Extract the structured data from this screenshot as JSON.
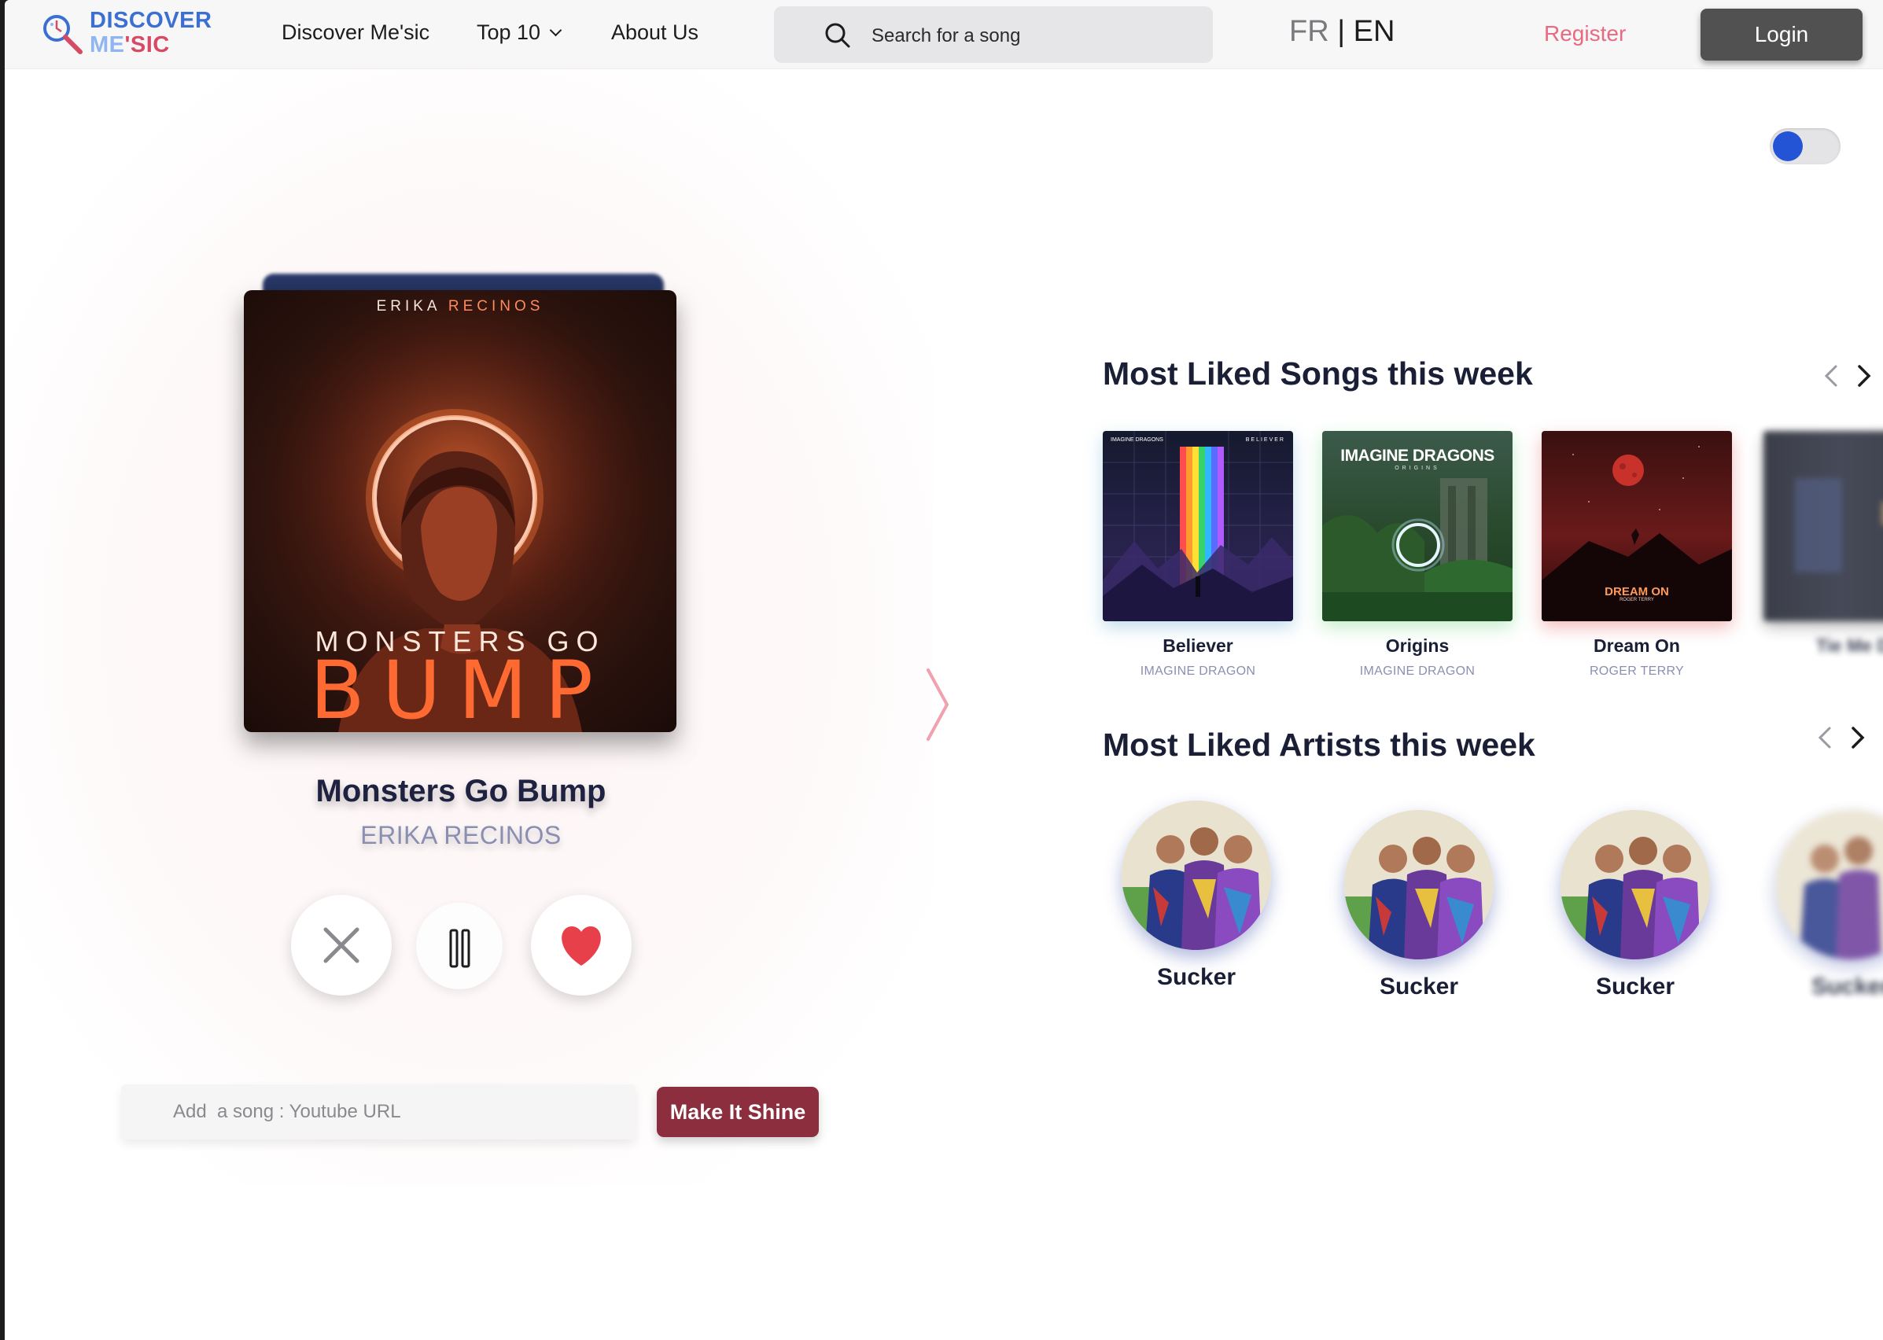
{
  "nav": {
    "logo_line1": "DISCOVER",
    "logo_line2_a": "ME",
    "logo_line2_b": "'SIC",
    "links": [
      "Discover Me'sic",
      "Top 10",
      "About Us"
    ],
    "search_placeholder": "Search for a song",
    "lang_fr": "FR",
    "lang_sep": " | ",
    "lang_en": "EN",
    "register": "Register",
    "login": "Login"
  },
  "player": {
    "cover_artist": {
      "first": "ERIKA",
      "last": "RECINOS"
    },
    "cover_title_small": "MONSTERS GO",
    "cover_title_big": "BUMP",
    "title": "Monsters Go Bump",
    "artist": "ERIKA RECINOS",
    "url_placeholder": "Add  a song : Youtube URL",
    "submit": "Make It Shine"
  },
  "theme_toggle": {
    "on": false,
    "knob_color": "#2454d6"
  },
  "songs_section": {
    "title": "Most Liked Songs this week",
    "items": [
      {
        "name": "Believer",
        "artist": "IMAGINE DRAGON"
      },
      {
        "name": "Origins",
        "artist": "IMAGINE DRAGON"
      },
      {
        "name": "Dream On",
        "artist": "ROGER TERRY"
      },
      {
        "name": "Tie Me Do",
        "artist": ""
      }
    ],
    "art_text": {
      "believer_band": "IMAGINE DRAGONS",
      "believer_title": "BELIEVER",
      "origins_band": "IMAGINE DRAGONS",
      "origins_sub": "ORIGINS",
      "dream_title": "DREAM ON",
      "dream_artist": "ROGER TERRY"
    }
  },
  "artists_section": {
    "title": "Most Liked Artists this week",
    "items": [
      {
        "name": "Sucker"
      },
      {
        "name": "Sucker"
      },
      {
        "name": "Sucker"
      },
      {
        "name": "Sucker"
      }
    ]
  },
  "colors": {
    "accent_pink": "#e86a80",
    "button_dark": "#515151",
    "shine_button": "#8c2e3e",
    "heading": "#1a1f36",
    "subtle": "#8a8fb2"
  }
}
